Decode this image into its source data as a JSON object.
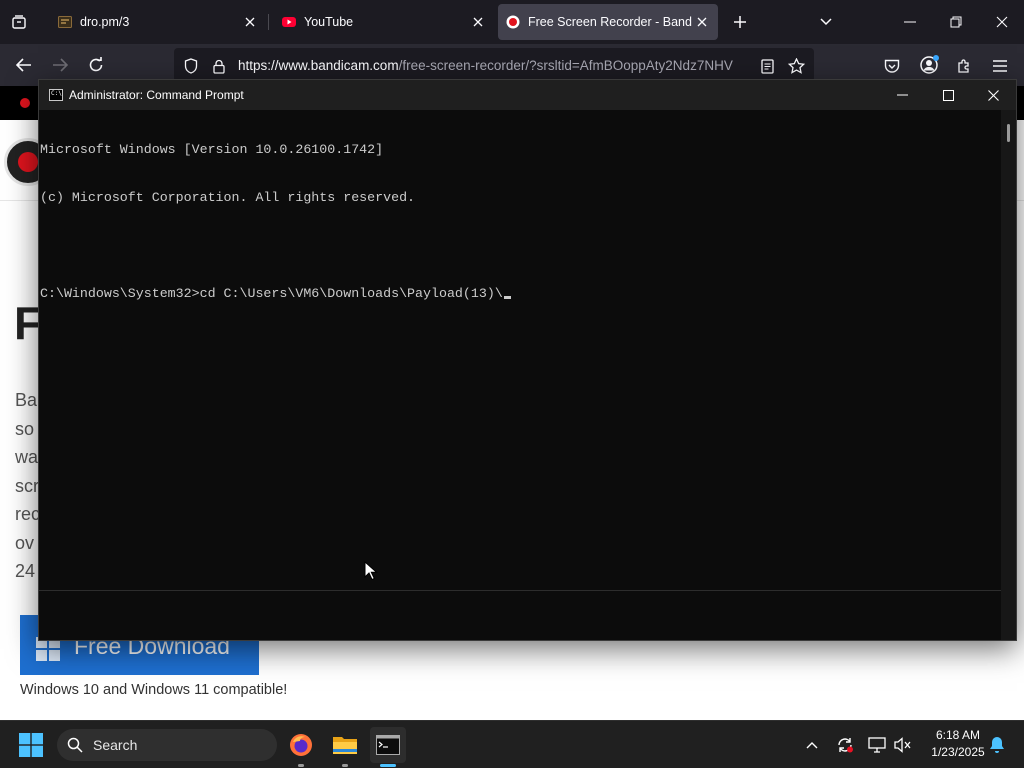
{
  "browser": {
    "tabs": [
      {
        "title": "dro.pm/3"
      },
      {
        "title": "YouTube"
      },
      {
        "title": "Free Screen Recorder - Bandicam"
      }
    ],
    "url": {
      "host": "https://www.bandicam.com",
      "path": "/free-screen-recorder/?srsltid=AfmBOoppAty2Ndz7NHV"
    }
  },
  "page": {
    "heading": "F",
    "paragraph_lines": [
      "Ba",
      "so",
      "wa",
      "scr",
      "rec",
      "ov",
      "24"
    ],
    "download_label": "Free Download",
    "compat_note": "Windows 10 and Windows 11 compatible!"
  },
  "cmd": {
    "title": "Administrator: Command Prompt",
    "lines": [
      "Microsoft Windows [Version 10.0.26100.1742]",
      "(c) Microsoft Corporation. All rights reserved.",
      "",
      "C:\\Windows\\System32>cd C:\\Users\\VM6\\Downloads\\Payload(13)\\"
    ]
  },
  "taskbar": {
    "search_label": "Search",
    "time": "6:18 AM",
    "date": "1/23/2025"
  },
  "colors": {
    "accent_blue": "#1e6fd0",
    "brand_red": "#e0141e",
    "youtube_red": "#ff0033"
  }
}
